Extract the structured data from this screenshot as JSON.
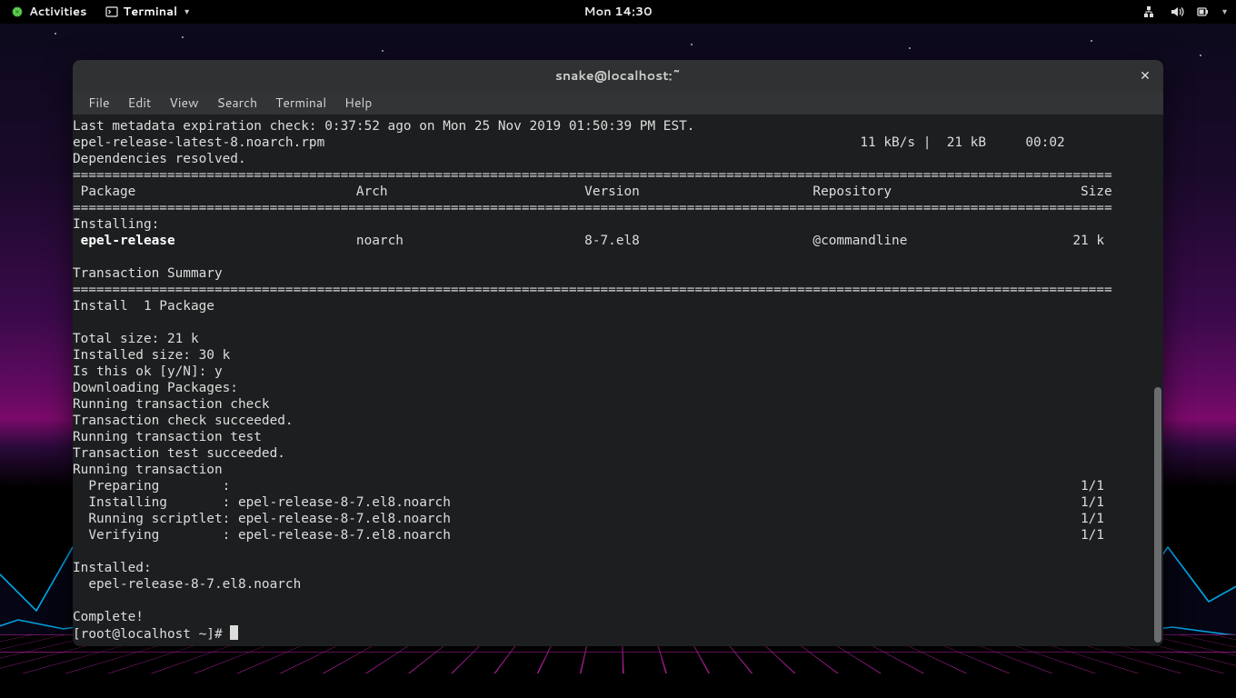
{
  "topbar": {
    "activities": "Activities",
    "app_label": "Terminal",
    "clock": "Mon 14:30"
  },
  "window": {
    "title": "snake@localhost:~"
  },
  "menubar": {
    "file": "File",
    "edit": "Edit",
    "view": "View",
    "search": "Search",
    "terminal": "Terminal",
    "help": "Help"
  },
  "term": {
    "l0": "Last metadata expiration check: 0:37:52 ago on Mon 25 Nov 2019 01:50:39 PM EST.",
    "l1": "epel-release-latest-8.noarch.rpm                                                                    11 kB/s |  21 kB     00:02",
    "l2": "Dependencies resolved.",
    "eq1": "====================================================================================================================================",
    "hdr": " Package                            Arch                         Version                      Repository                        Size",
    "eq2": "====================================================================================================================================",
    "inst": "Installing:",
    "pkg_name": " epel-release",
    "pkg_rest": "                       noarch                       8-7.el8                      @commandline                     21 k",
    "ts": "Transaction Summary",
    "eq3": "====================================================================================================================================",
    "summary": "Install  1 Package",
    "total": "Total size: 21 k",
    "isz": "Installed size: 30 k",
    "ok": "Is this ok [y/N]: y",
    "dl": "Downloading Packages:",
    "rtc": "Running transaction check",
    "tcs": "Transaction check succeeded.",
    "rtt": "Running transaction test",
    "tts": "Transaction test succeeded.",
    "rt": "Running transaction",
    "p1": "  Preparing        :                                                                                                            1/1",
    "p2": "  Installing       : epel-release-8-7.el8.noarch                                                                                1/1",
    "p3": "  Running scriptlet: epel-release-8-7.el8.noarch                                                                                1/1",
    "p4": "  Verifying        : epel-release-8-7.el8.noarch                                                                                1/1",
    "inst2": "Installed:",
    "inst3": "  epel-release-8-7.el8.noarch",
    "comp": "Complete!",
    "prompt": "[root@localhost ~]# "
  }
}
